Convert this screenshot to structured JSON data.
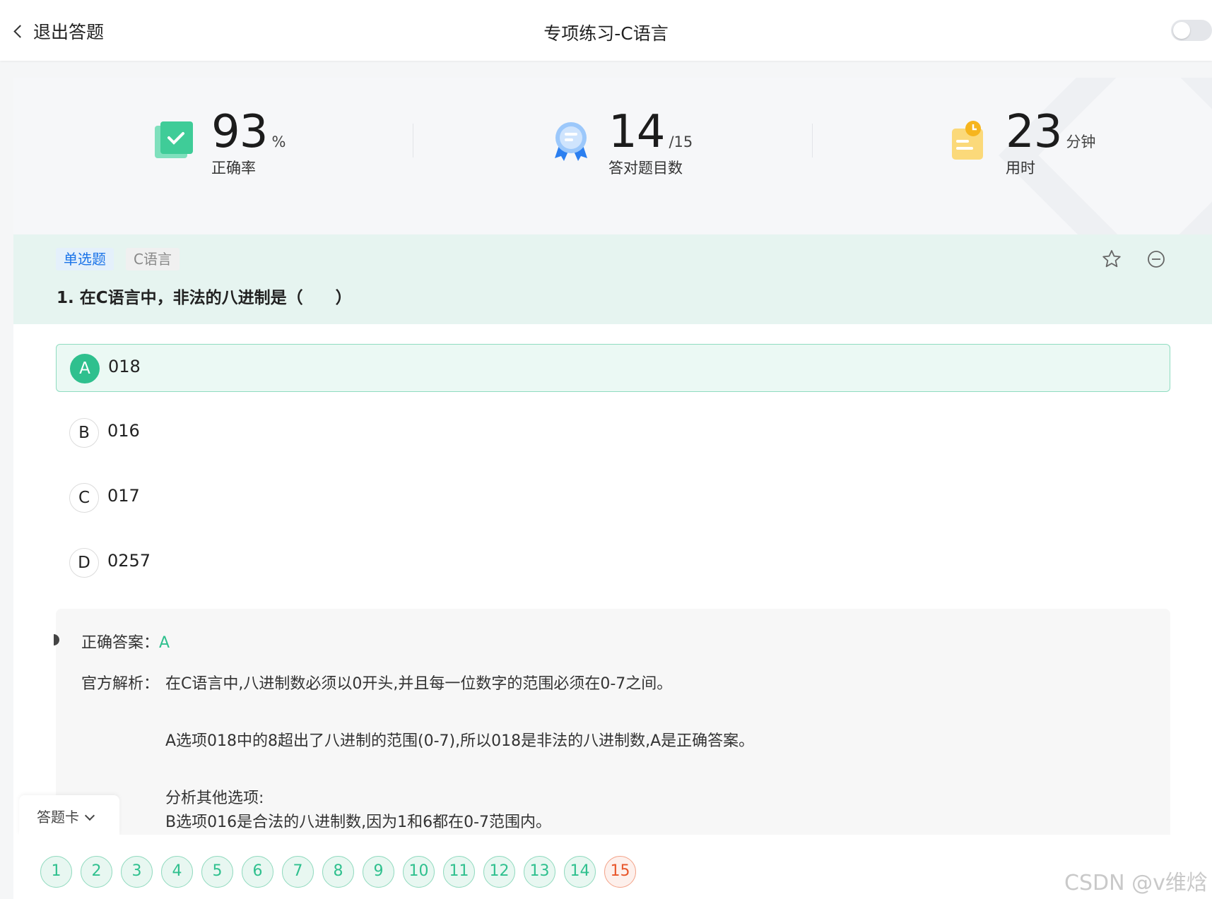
{
  "header": {
    "back_label": "退出答题",
    "title": "专项练习-C语言"
  },
  "stats": [
    {
      "value": "93",
      "unit": "%",
      "label": "正确率",
      "icon": "checkbook-icon"
    },
    {
      "value": "14",
      "unit": "/15",
      "label": "答对题目数",
      "icon": "medal-icon"
    },
    {
      "value": "23",
      "unit": "分钟",
      "label": "用时",
      "icon": "clock-note-icon"
    }
  ],
  "question": {
    "type_tag": "单选题",
    "lang_tag": "C语言",
    "text": "1. 在C语言中，非法的八进制是（　　）",
    "options": [
      {
        "letter": "A",
        "text": "018",
        "selected": true
      },
      {
        "letter": "B",
        "text": "016",
        "selected": false
      },
      {
        "letter": "C",
        "text": "017",
        "selected": false
      },
      {
        "letter": "D",
        "text": "0257",
        "selected": false
      }
    ]
  },
  "analysis": {
    "answer_label": "正确答案：",
    "answer_value": "A",
    "explain_label": "官方解析：",
    "lines": [
      "在C语言中,八进制数必须以0开头,并且每一位数字的范围必须在0-7之间。",
      "A选项018中的8超出了八进制的范围(0-7),所以018是非法的八进制数,A是正确答案。",
      "分析其他选项:",
      "B选项016是合法的八进制数,因为1和6都在0-7范围内。"
    ]
  },
  "answer_card": {
    "label": "答题卡",
    "numbers": [
      "1",
      "2",
      "3",
      "4",
      "5",
      "6",
      "7",
      "8",
      "9",
      "10",
      "11",
      "12",
      "13",
      "14",
      "15"
    ],
    "wrong": [
      "15"
    ]
  },
  "watermark": "CSDN @v维焓",
  "colors": {
    "accent": "#2fc08e",
    "wrong": "#e8562a",
    "tag_blue": "#1a73e8"
  }
}
